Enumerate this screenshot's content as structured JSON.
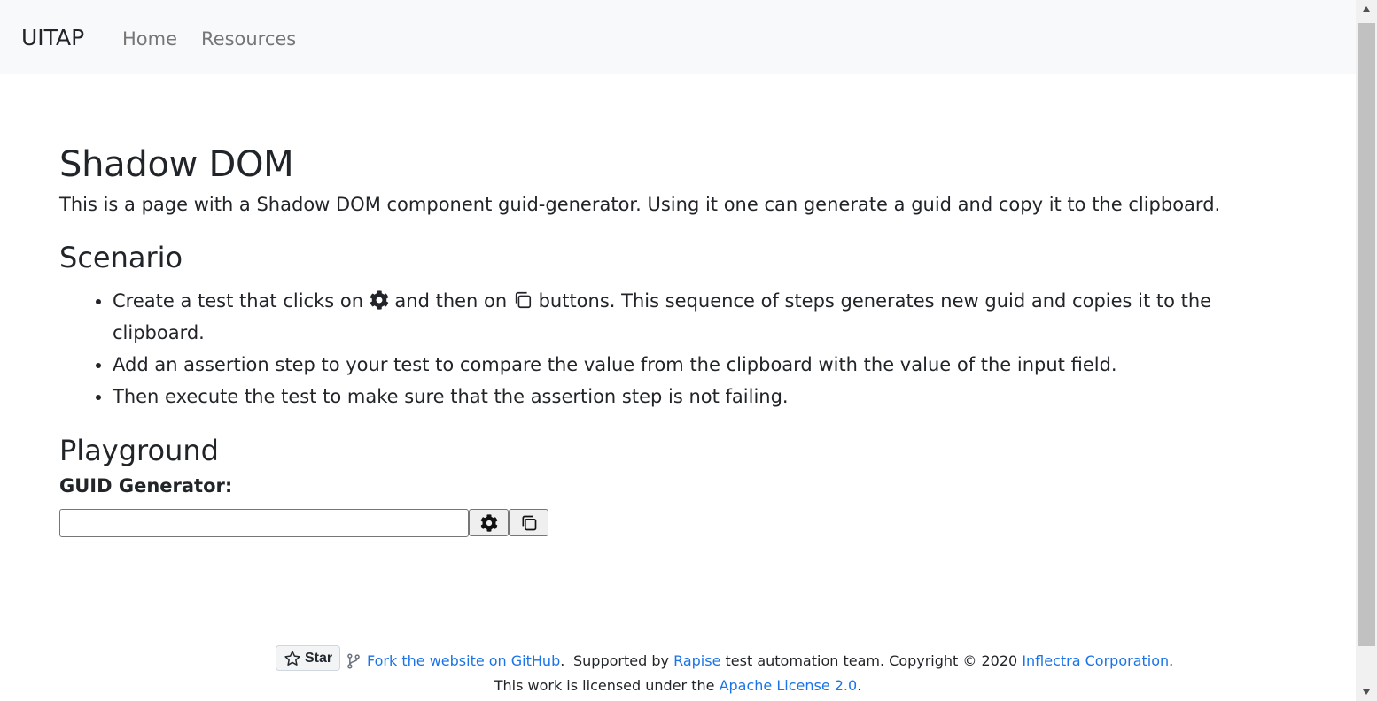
{
  "navbar": {
    "brand": "UITAP",
    "links": [
      "Home",
      "Resources"
    ]
  },
  "main": {
    "title": "Shadow DOM",
    "lead": "This is a page with a Shadow DOM component guid-generator. Using it one can generate a guid and copy it to the clipboard.",
    "scenario_heading": "Scenario",
    "scenario_steps": {
      "step1_a": "Create a test that clicks on",
      "step1_b": "and then on",
      "step1_c": "buttons. This sequence of steps generates new guid and copies it to the clipboard.",
      "step2": "Add an assertion step to your test to compare the value from the clipboard with the value of the input field.",
      "step3": "Then execute the test to make sure that the assertion step is not failing."
    },
    "playground_heading": "Playground",
    "generator_label": "GUID Generator:",
    "guid_value": "",
    "generate_icon": "gear-icon",
    "copy_icon": "copy-icon"
  },
  "footer": {
    "star_label": "Star",
    "fork_link": "Fork the website on GitHub",
    "fork_suffix": ".",
    "supported_prefix": "Supported by",
    "rapise_link": "Rapise",
    "supported_middle": "test automation team. Copyright © 2020",
    "inflectra_link": "Inflectra Corporation",
    "supported_suffix": ".",
    "license_prefix": "This work is licensed under the",
    "license_link": "Apache License 2.0",
    "license_suffix": "."
  },
  "colors": {
    "navbar_bg": "#f8f9fa",
    "link": "#1a73e8",
    "text": "#212529",
    "nav_muted": "#767676"
  }
}
